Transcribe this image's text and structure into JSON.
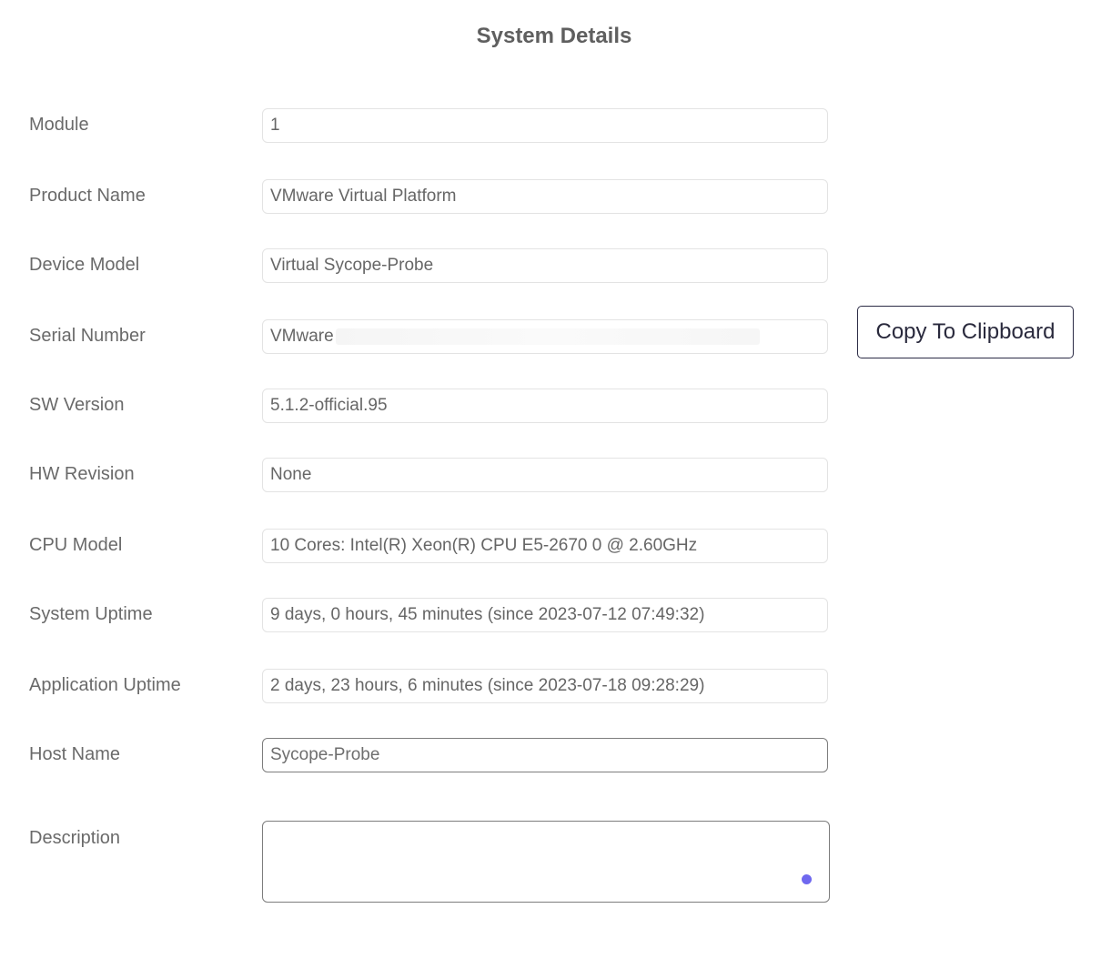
{
  "page": {
    "title": "System Details"
  },
  "fields": {
    "module": {
      "label": "Module",
      "value": "1"
    },
    "product_name": {
      "label": "Product Name",
      "value": "VMware Virtual Platform"
    },
    "device_model": {
      "label": "Device Model",
      "value": "Virtual Sycope-Probe"
    },
    "serial_number": {
      "label": "Serial Number",
      "value": "VMware"
    },
    "sw_version": {
      "label": "SW Version",
      "value": "5.1.2-official.95"
    },
    "hw_revision": {
      "label": "HW Revision",
      "value": "None"
    },
    "cpu_model": {
      "label": "CPU Model",
      "value": "10 Cores: Intel(R) Xeon(R) CPU E5-2670 0 @ 2.60GHz"
    },
    "system_uptime": {
      "label": "System Uptime",
      "value": "9 days, 0 hours, 45 minutes (since 2023-07-12 07:49:32)"
    },
    "application_uptime": {
      "label": "Application Uptime",
      "value": "2 days, 23 hours, 6 minutes (since 2023-07-18 09:28:29)"
    },
    "host_name": {
      "label": "Host Name",
      "value": "Sycope-Probe"
    },
    "description": {
      "label": "Description",
      "value": ""
    }
  },
  "actions": {
    "copy_label": "Copy To Clipboard"
  },
  "colors": {
    "accent_dot": "#6f68ef",
    "button_border": "#2b2b45"
  }
}
